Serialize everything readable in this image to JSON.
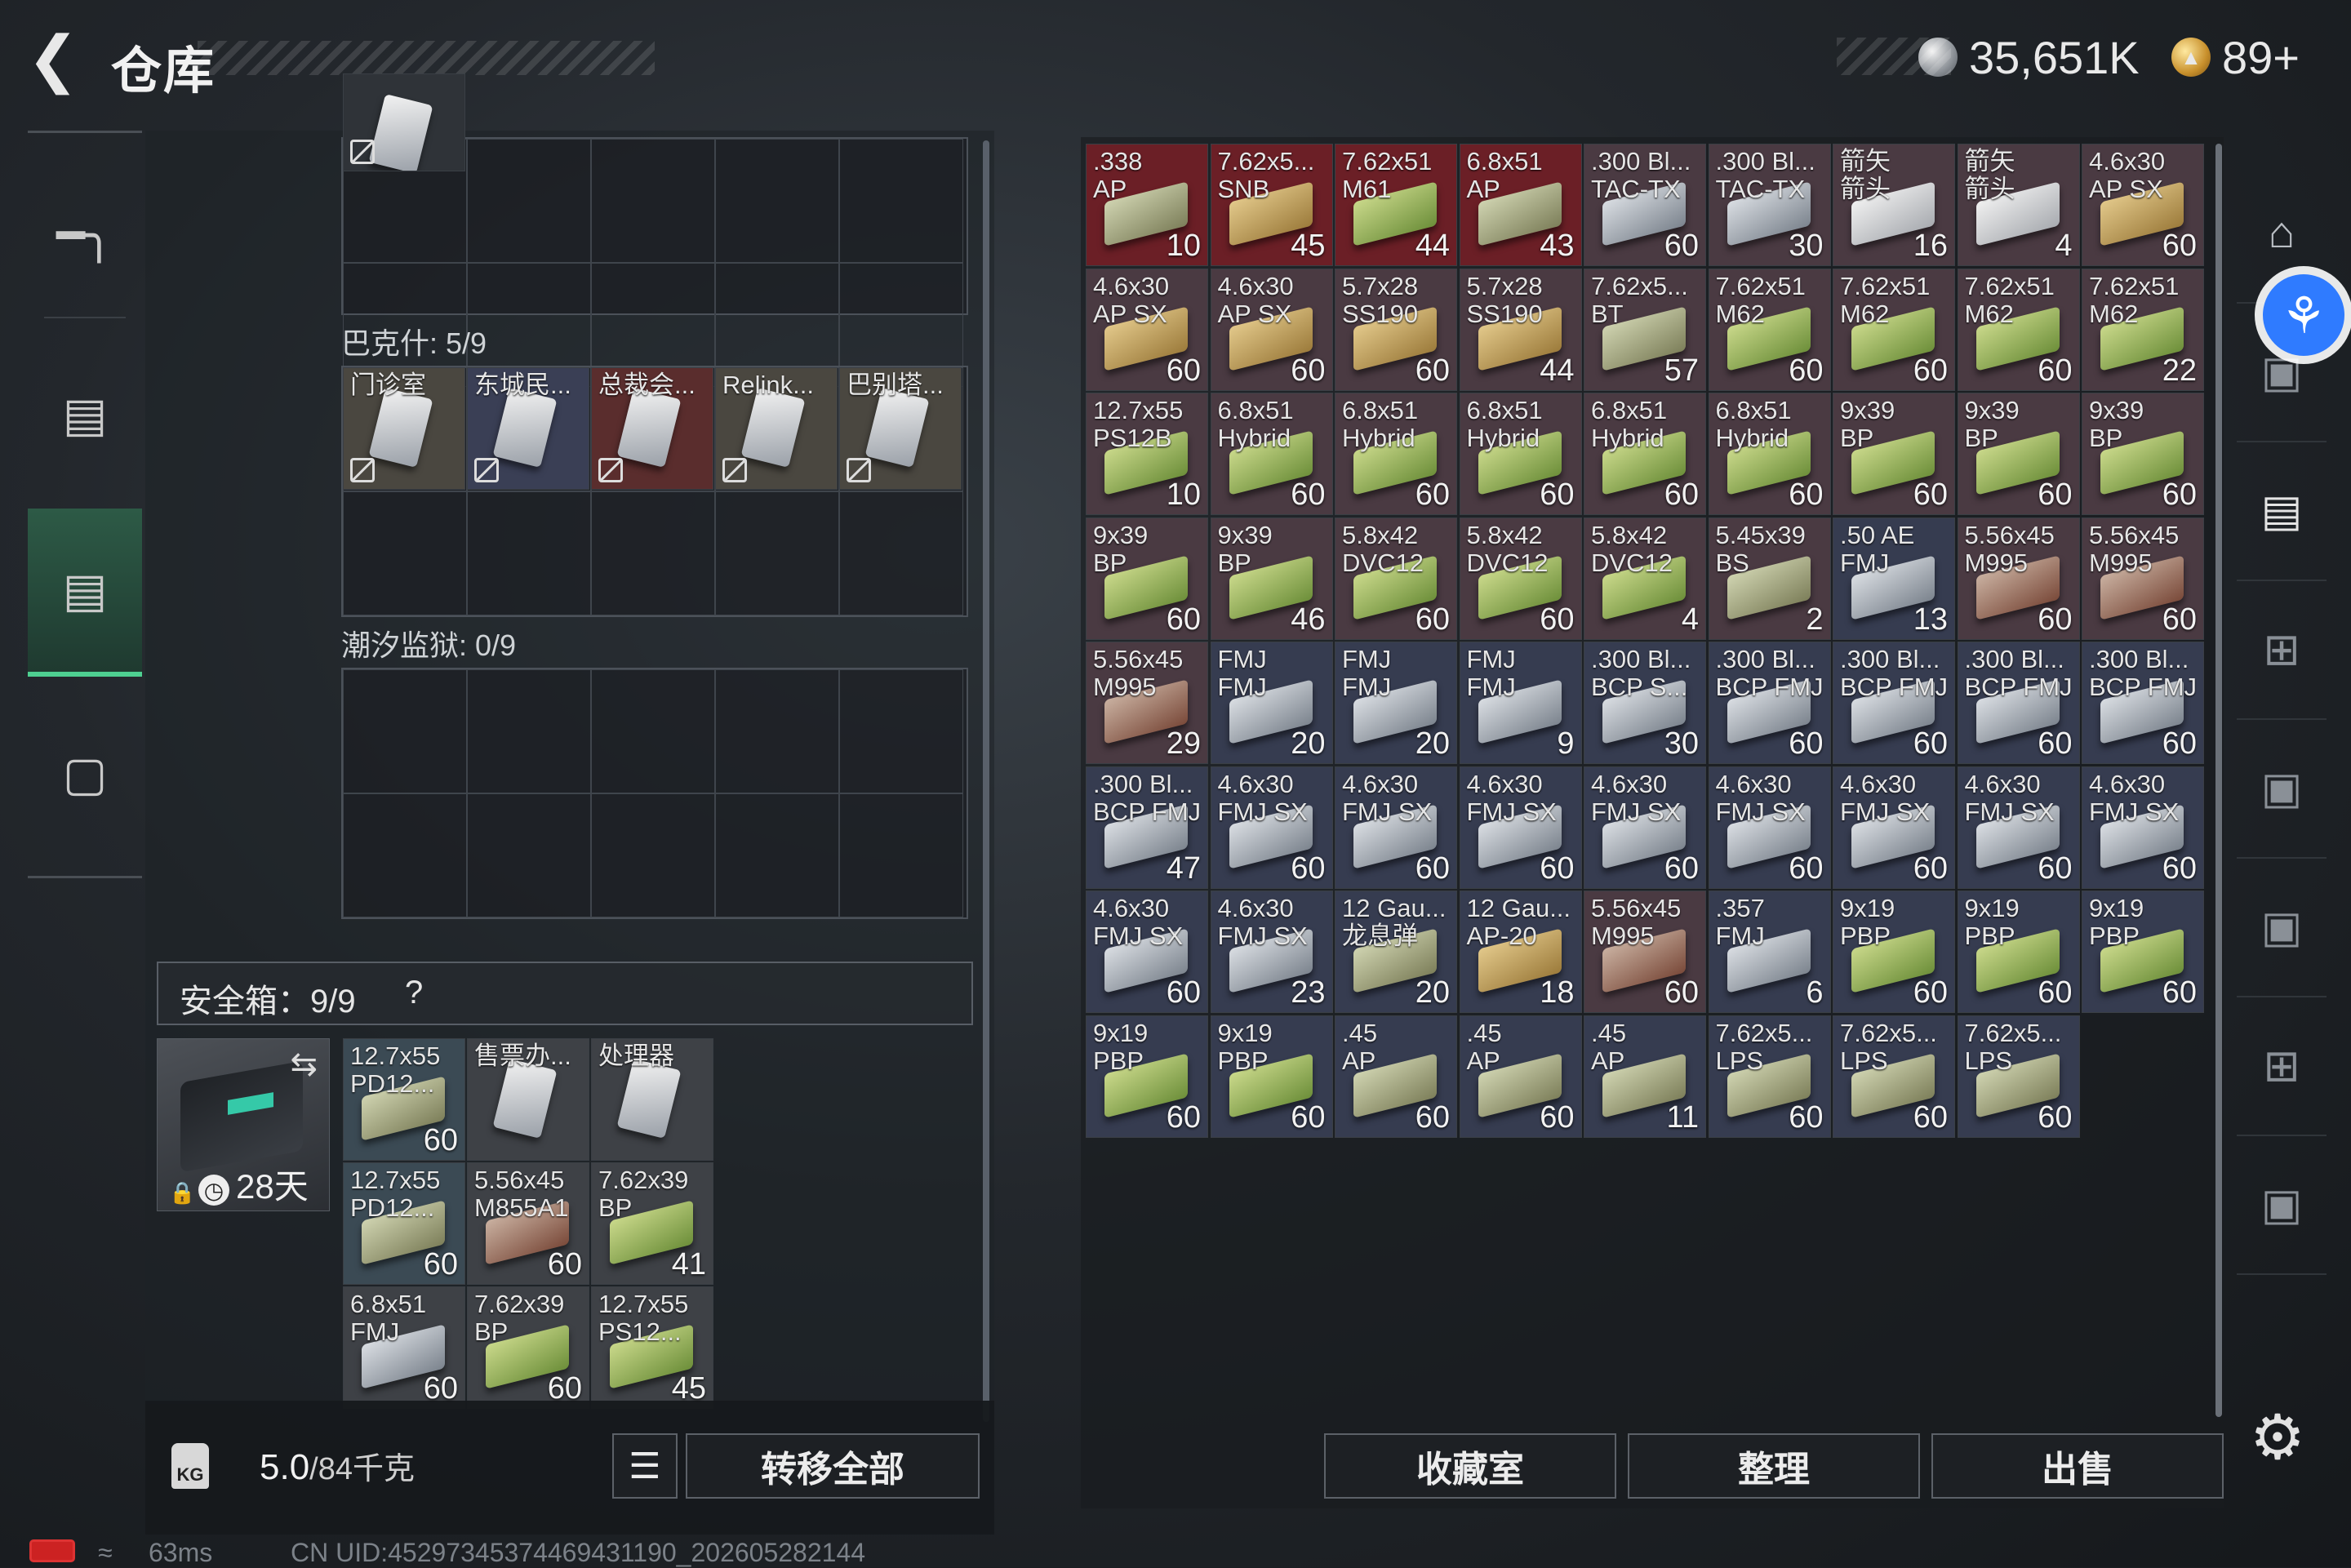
{
  "header": {
    "title": "仓库",
    "currency1": "35,651K",
    "currency2": "89+"
  },
  "sidebar": {
    "items": [
      "weapon",
      "backpack",
      "storage",
      "toolbox"
    ],
    "active_index": 2
  },
  "sections": {
    "top_grid_label": "",
    "bakesh_label": "巴克什: 5/9",
    "tide_label": "潮汐监狱: 0/9",
    "bakesh_items": [
      {
        "name": "门诊室",
        "color": "#4a4740"
      },
      {
        "name": "东城民...",
        "color": "#3a3f55"
      },
      {
        "name": "总裁会...",
        "color": "#5a2d2d"
      },
      {
        "name": "Relink...",
        "color": "#4a4740"
      },
      {
        "name": "巴别塔...",
        "color": "#4a4740"
      }
    ]
  },
  "safe": {
    "label": "安全箱：9/9",
    "help": "?",
    "timer": "28天",
    "items": [
      {
        "name": "12.7x55\nPD12...",
        "count": "60",
        "color": "#3b4a54"
      },
      {
        "name": "售票办...",
        "count": "",
        "color": "#3e4146"
      },
      {
        "name": "处理器",
        "count": "",
        "color": "#3e4146"
      },
      {
        "name": "12.7x55\nPD12...",
        "count": "60",
        "color": "#3b4a54"
      },
      {
        "name": "5.56x45\nM855A1",
        "count": "60",
        "color": "#3e4146"
      },
      {
        "name": "7.62x39\nBP",
        "count": "41",
        "color": "#3e4146"
      },
      {
        "name": "6.8x51\nFMJ",
        "count": "60",
        "color": "#3e4146"
      },
      {
        "name": "7.62x39\nBP",
        "count": "60",
        "color": "#3e4146"
      },
      {
        "name": "12.7x55\nPS12...",
        "count": "45",
        "color": "#3e4146"
      }
    ]
  },
  "bottom": {
    "weight_current": "5.0",
    "weight_max": "/84千克",
    "transfer_all": "转移全部"
  },
  "storage": {
    "items": [
      {
        "name": ".338\nAP",
        "count": "10",
        "color": "#6b1f26"
      },
      {
        "name": "7.62x5...\nSNB",
        "count": "45",
        "color": "#6b1f26"
      },
      {
        "name": "7.62x51\nM61",
        "count": "44",
        "color": "#6b1f26"
      },
      {
        "name": "6.8x51\nAP",
        "count": "43",
        "color": "#6b1f26"
      },
      {
        "name": ".300 Bl...\nTAC-TX",
        "count": "60",
        "color": "#4a3a42"
      },
      {
        "name": ".300 Bl...\nTAC-TX",
        "count": "30",
        "color": "#4a3a42"
      },
      {
        "name": "箭矢\n箭头",
        "count": "16",
        "color": "#4a3a42"
      },
      {
        "name": "箭矢\n箭头",
        "count": "4",
        "color": "#4a3a42"
      },
      {
        "name": "4.6x30\nAP SX",
        "count": "60",
        "color": "#4a3a42"
      },
      {
        "name": "4.6x30\nAP SX",
        "count": "60",
        "color": "#4a3a42"
      },
      {
        "name": "4.6x30\nAP SX",
        "count": "60",
        "color": "#4a3a42"
      },
      {
        "name": "5.7x28\nSS190",
        "count": "60",
        "color": "#4a3a42"
      },
      {
        "name": "5.7x28\nSS190",
        "count": "44",
        "color": "#4a3a42"
      },
      {
        "name": "7.62x5...\nBT",
        "count": "57",
        "color": "#4a3a42"
      },
      {
        "name": "7.62x51\nM62",
        "count": "60",
        "color": "#4a3a42"
      },
      {
        "name": "7.62x51\nM62",
        "count": "60",
        "color": "#4a3a42"
      },
      {
        "name": "7.62x51\nM62",
        "count": "60",
        "color": "#4a3a42"
      },
      {
        "name": "7.62x51\nM62",
        "count": "22",
        "color": "#4a3a42"
      },
      {
        "name": "12.7x55\nPS12B",
        "count": "10",
        "color": "#4a3a42"
      },
      {
        "name": "6.8x51\nHybrid",
        "count": "60",
        "color": "#4a3a42"
      },
      {
        "name": "6.8x51\nHybrid",
        "count": "60",
        "color": "#4a3a42"
      },
      {
        "name": "6.8x51\nHybrid",
        "count": "60",
        "color": "#4a3a42"
      },
      {
        "name": "6.8x51\nHybrid",
        "count": "60",
        "color": "#4a3a42"
      },
      {
        "name": "6.8x51\nHybrid",
        "count": "60",
        "color": "#4a3a42"
      },
      {
        "name": "9x39\nBP",
        "count": "60",
        "color": "#4a3a42"
      },
      {
        "name": "9x39\nBP",
        "count": "60",
        "color": "#4a3a42"
      },
      {
        "name": "9x39\nBP",
        "count": "60",
        "color": "#4a3a42"
      },
      {
        "name": "9x39\nBP",
        "count": "60",
        "color": "#4a3a42"
      },
      {
        "name": "9x39\nBP",
        "count": "46",
        "color": "#4a3a42"
      },
      {
        "name": "5.8x42\nDVC12",
        "count": "60",
        "color": "#4a3a42"
      },
      {
        "name": "5.8x42\nDVC12",
        "count": "60",
        "color": "#4a3a42"
      },
      {
        "name": "5.8x42\nDVC12",
        "count": "4",
        "color": "#4a3a42"
      },
      {
        "name": "5.45x39\nBS",
        "count": "2",
        "color": "#4a3a42"
      },
      {
        "name": ".50 AE\nFMJ",
        "count": "13",
        "color": "#363c50"
      },
      {
        "name": "5.56x45\nM995",
        "count": "60",
        "color": "#4a3a42"
      },
      {
        "name": "5.56x45\nM995",
        "count": "60",
        "color": "#4a3a42"
      },
      {
        "name": "5.56x45\nM995",
        "count": "29",
        "color": "#4a3a42"
      },
      {
        "name": "FMJ\nFMJ",
        "count": "20",
        "color": "#363c50"
      },
      {
        "name": "FMJ\nFMJ",
        "count": "20",
        "color": "#363c50"
      },
      {
        "name": "FMJ\nFMJ",
        "count": "9",
        "color": "#363c50"
      },
      {
        "name": ".300 Bl...\nBCP S...",
        "count": "30",
        "color": "#363c50"
      },
      {
        "name": ".300 Bl...\nBCP FMJ",
        "count": "60",
        "color": "#363c50"
      },
      {
        "name": ".300 Bl...\nBCP FMJ",
        "count": "60",
        "color": "#363c50"
      },
      {
        "name": ".300 Bl...\nBCP FMJ",
        "count": "60",
        "color": "#363c50"
      },
      {
        "name": ".300 Bl...\nBCP FMJ",
        "count": "60",
        "color": "#363c50"
      },
      {
        "name": ".300 Bl...\nBCP FMJ",
        "count": "47",
        "color": "#363c50"
      },
      {
        "name": "4.6x30\nFMJ SX",
        "count": "60",
        "color": "#363c50"
      },
      {
        "name": "4.6x30\nFMJ SX",
        "count": "60",
        "color": "#363c50"
      },
      {
        "name": "4.6x30\nFMJ SX",
        "count": "60",
        "color": "#363c50"
      },
      {
        "name": "4.6x30\nFMJ SX",
        "count": "60",
        "color": "#363c50"
      },
      {
        "name": "4.6x30\nFMJ SX",
        "count": "60",
        "color": "#363c50"
      },
      {
        "name": "4.6x30\nFMJ SX",
        "count": "60",
        "color": "#363c50"
      },
      {
        "name": "4.6x30\nFMJ SX",
        "count": "60",
        "color": "#363c50"
      },
      {
        "name": "4.6x30\nFMJ SX",
        "count": "60",
        "color": "#363c50"
      },
      {
        "name": "4.6x30\nFMJ SX",
        "count": "60",
        "color": "#363c50"
      },
      {
        "name": "4.6x30\nFMJ SX",
        "count": "23",
        "color": "#363c50"
      },
      {
        "name": "12 Gau...\n龙息弹",
        "count": "20",
        "color": "#363c50"
      },
      {
        "name": "12 Gau...\nAP-20",
        "count": "18",
        "color": "#363c50"
      },
      {
        "name": "5.56x45\nM995",
        "count": "60",
        "color": "#4a3a42"
      },
      {
        "name": ".357\nFMJ",
        "count": "6",
        "color": "#363c50"
      },
      {
        "name": "9x19\nPBP",
        "count": "60",
        "color": "#363c50"
      },
      {
        "name": "9x19\nPBP",
        "count": "60",
        "color": "#363c50"
      },
      {
        "name": "9x19\nPBP",
        "count": "60",
        "color": "#363c50"
      },
      {
        "name": "9x19\nPBP",
        "count": "60",
        "color": "#363c50"
      },
      {
        "name": "9x19\nPBP",
        "count": "60",
        "color": "#363c50"
      },
      {
        "name": ".45\nAP",
        "count": "60",
        "color": "#363c50"
      },
      {
        "name": ".45\nAP",
        "count": "60",
        "color": "#363c50"
      },
      {
        "name": ".45\nAP",
        "count": "11",
        "color": "#363c50"
      },
      {
        "name": "7.62x5...\nLPS",
        "count": "60",
        "color": "#363c50"
      },
      {
        "name": "7.62x5...\nLPS",
        "count": "60",
        "color": "#363c50"
      },
      {
        "name": "7.62x5...\nLPS",
        "count": "60",
        "color": "#363c50"
      }
    ]
  },
  "actions": {
    "collection": "收藏室",
    "sort": "整理",
    "sell": "出售"
  },
  "status": {
    "ping": "63ms",
    "uid": "CN UID:4529734537446943​1190_202605282144"
  }
}
